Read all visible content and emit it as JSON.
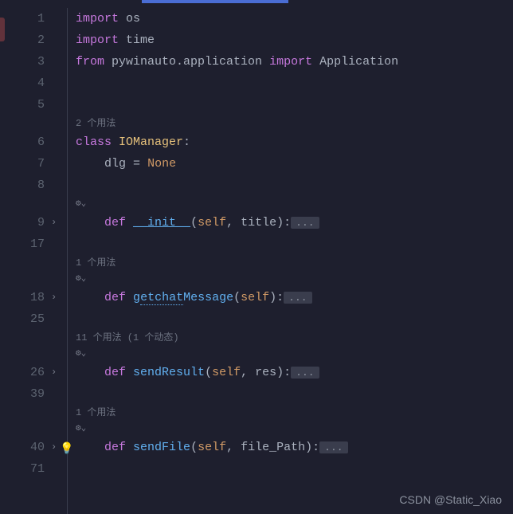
{
  "lines": [
    {
      "num": "1",
      "type": "code",
      "tokens": [
        [
          "kw-import",
          "import"
        ],
        [
          "",
          " "
        ],
        [
          "mod-name",
          "os"
        ]
      ]
    },
    {
      "num": "2",
      "type": "code",
      "tokens": [
        [
          "kw-import",
          "import"
        ],
        [
          "",
          " "
        ],
        [
          "mod-name",
          "time"
        ]
      ]
    },
    {
      "num": "3",
      "type": "code",
      "tokens": [
        [
          "kw-from",
          "from"
        ],
        [
          "",
          " "
        ],
        [
          "mod-name",
          "pywinauto.application"
        ],
        [
          "",
          " "
        ],
        [
          "kw-import",
          "import"
        ],
        [
          "",
          " "
        ],
        [
          "mod-name",
          "Application"
        ]
      ]
    },
    {
      "num": "4",
      "type": "code",
      "tokens": []
    },
    {
      "num": "5",
      "type": "code",
      "tokens": []
    },
    {
      "type": "hint",
      "text": "2 个用法",
      "indent": 0
    },
    {
      "num": "6",
      "type": "code",
      "tokens": [
        [
          "kw-class",
          "class"
        ],
        [
          "",
          " "
        ],
        [
          "cls-name",
          "IOManager"
        ],
        [
          "punct",
          ":"
        ]
      ]
    },
    {
      "num": "7",
      "type": "code",
      "tokens": [
        [
          "",
          "    "
        ],
        [
          "mod-name",
          "dlg"
        ],
        [
          "",
          " "
        ],
        [
          "punct",
          "="
        ],
        [
          "",
          " "
        ],
        [
          "none-lit",
          "None"
        ]
      ]
    },
    {
      "num": "8",
      "type": "code",
      "tokens": []
    },
    {
      "type": "gutter-icon",
      "indent": 4
    },
    {
      "num": "9",
      "type": "code",
      "fold": true,
      "tokens": [
        [
          "",
          "    "
        ],
        [
          "kw-def",
          "def"
        ],
        [
          "",
          " "
        ],
        [
          "underscore-init",
          "__init__"
        ],
        [
          "punct",
          "("
        ],
        [
          "self",
          "self"
        ],
        [
          "punct",
          ","
        ],
        [
          "",
          " "
        ],
        [
          "param",
          "title"
        ],
        [
          "punct",
          "):"
        ],
        [
          "ellipsis",
          "..."
        ]
      ]
    },
    {
      "num": "17",
      "type": "code",
      "tokens": []
    },
    {
      "type": "hint",
      "text": "1 个用法",
      "indent": 4
    },
    {
      "type": "gutter-icon",
      "indent": 4
    },
    {
      "num": "18",
      "type": "code",
      "fold": true,
      "tokens": [
        [
          "",
          "    "
        ],
        [
          "kw-def",
          "def"
        ],
        [
          "",
          " "
        ],
        [
          "func-name",
          "g"
        ],
        [
          "func-underline func-name",
          "etchat"
        ],
        [
          "func-name",
          "Message"
        ],
        [
          "punct",
          "("
        ],
        [
          "self",
          "self"
        ],
        [
          "punct",
          "):"
        ],
        [
          "ellipsis",
          "..."
        ]
      ]
    },
    {
      "num": "25",
      "type": "code",
      "tokens": []
    },
    {
      "type": "hint",
      "text": "11 个用法 (1 个动态)",
      "indent": 4
    },
    {
      "type": "gutter-icon",
      "indent": 4
    },
    {
      "num": "26",
      "type": "code",
      "fold": true,
      "tokens": [
        [
          "",
          "    "
        ],
        [
          "kw-def",
          "def"
        ],
        [
          "",
          " "
        ],
        [
          "func-name",
          "sendResult"
        ],
        [
          "punct",
          "("
        ],
        [
          "self",
          "self"
        ],
        [
          "punct",
          ","
        ],
        [
          "",
          " "
        ],
        [
          "param",
          "res"
        ],
        [
          "punct",
          "):"
        ],
        [
          "ellipsis",
          "..."
        ]
      ]
    },
    {
      "num": "39",
      "type": "code",
      "tokens": []
    },
    {
      "type": "hint",
      "text": "1 个用法",
      "indent": 4
    },
    {
      "type": "gutter-icon",
      "indent": 4
    },
    {
      "num": "40",
      "type": "code",
      "fold": true,
      "bulb": true,
      "tokens": [
        [
          "",
          "    "
        ],
        [
          "kw-def",
          "def"
        ],
        [
          "",
          " "
        ],
        [
          "func-name",
          "sendFile"
        ],
        [
          "punct",
          "("
        ],
        [
          "self",
          "self"
        ],
        [
          "punct",
          ","
        ],
        [
          "",
          " "
        ],
        [
          "param",
          "file_Path"
        ],
        [
          "punct",
          "):"
        ],
        [
          "ellipsis",
          "..."
        ]
      ]
    },
    {
      "num": "71",
      "type": "code",
      "tokens": []
    }
  ],
  "watermark": "CSDN @Static_Xiao",
  "indentSpaces": "    "
}
